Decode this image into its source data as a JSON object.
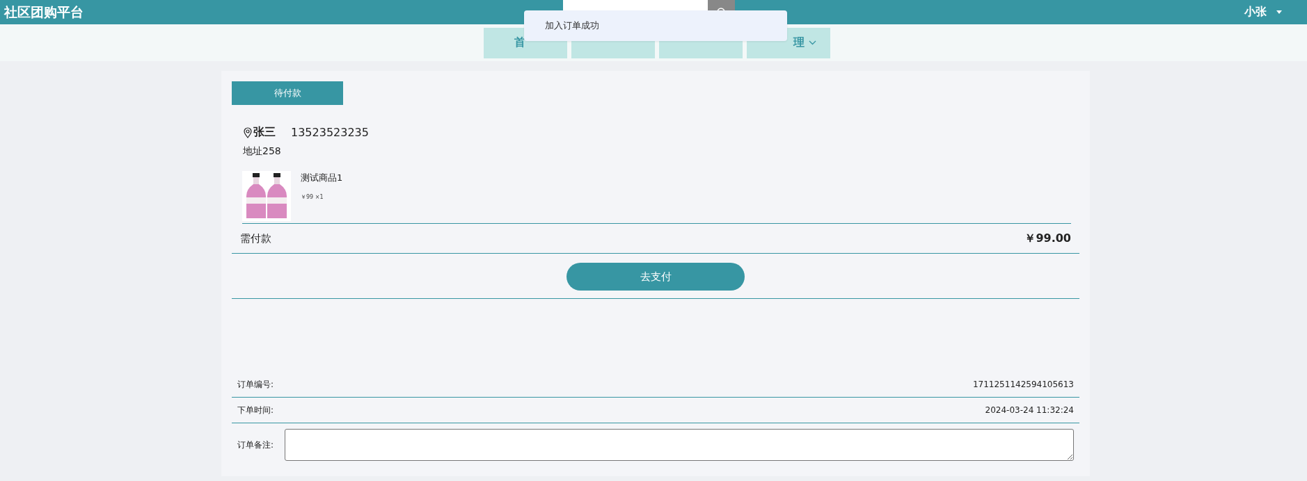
{
  "header": {
    "site_title": "社区团购平台",
    "user": "小张"
  },
  "nav": [
    {
      "label": "首",
      "dropdown": false
    },
    {
      "dropdown": false
    },
    {
      "dropdown": false
    },
    {
      "label": "理",
      "dropdown": true
    }
  ],
  "toast": {
    "message": "加入订单成功"
  },
  "order": {
    "status_tab": "待付款",
    "recipient": "张三",
    "phone": "13523523235",
    "address": "地址258",
    "items": [
      {
        "kind": "picture",
        "name": "测试商品1",
        "price": "￥99",
        "quantity": "×1"
      }
    ],
    "amount_label": "需付款",
    "amount": "￥99.00",
    "pay_button": "去支付",
    "details": [
      {
        "label": "订单编号:",
        "value": "1711251142594105613"
      },
      {
        "label": "下单时间:",
        "value": "2024-03-24 11:32:24"
      }
    ],
    "remark": {
      "label": "订单备注:"
    }
  }
}
